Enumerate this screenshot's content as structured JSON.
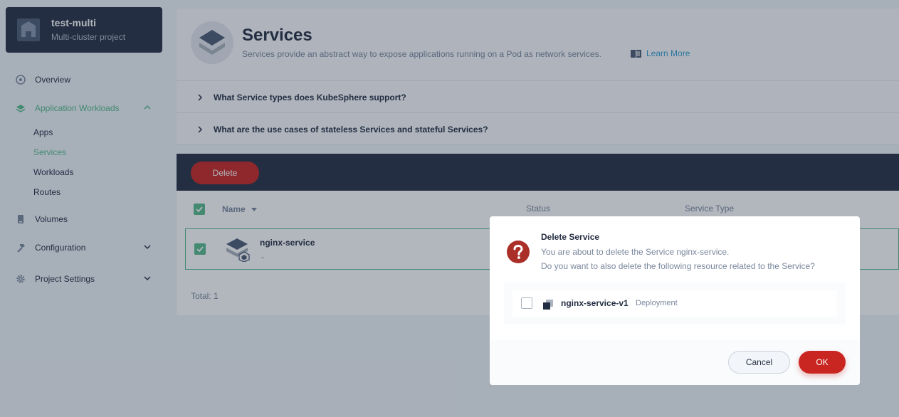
{
  "project": {
    "name": "test-multi",
    "subtitle": "Multi-cluster project"
  },
  "sidebar": {
    "items": [
      {
        "label": "Overview",
        "icon": "dashboard-icon"
      },
      {
        "label": "Application Workloads",
        "icon": "appcenter-icon",
        "expanded": true,
        "children": [
          {
            "label": "Apps"
          },
          {
            "label": "Services",
            "active": true
          },
          {
            "label": "Workloads"
          },
          {
            "label": "Routes"
          }
        ]
      },
      {
        "label": "Volumes",
        "icon": "storage-icon"
      },
      {
        "label": "Configuration",
        "icon": "hammer-icon",
        "expanded": false
      },
      {
        "label": "Project Settings",
        "icon": "gear-icon",
        "expanded": false
      }
    ]
  },
  "header": {
    "title": "Services",
    "description": "Services provide an abstract way to expose applications running on a Pod as network services.",
    "learn_more": "Learn More"
  },
  "faq": [
    {
      "question": "What Service types does KubeSphere support?"
    },
    {
      "question": "What are the use cases of stateless Services and stateful Services?"
    }
  ],
  "table": {
    "delete_label": "Delete",
    "columns": [
      "Name",
      "Status",
      "Service Type"
    ],
    "rows": [
      {
        "name": "nginx-service",
        "sub": "-",
        "selected": true
      }
    ],
    "total": "Total: 1"
  },
  "modal": {
    "title": "Delete Service",
    "line1": "You are about to delete the Service nginx-service.",
    "line2": "Do you want to also delete the following resource related to the Service?",
    "resource": {
      "name": "nginx-service-v1",
      "type": "Deployment",
      "checked": false
    },
    "cancel_label": "Cancel",
    "ok_label": "OK"
  },
  "colors": {
    "accent_green": "#55bc8a",
    "danger_red": "#ca2621",
    "dark_navy": "#242e42",
    "link_blue": "#329dce"
  }
}
